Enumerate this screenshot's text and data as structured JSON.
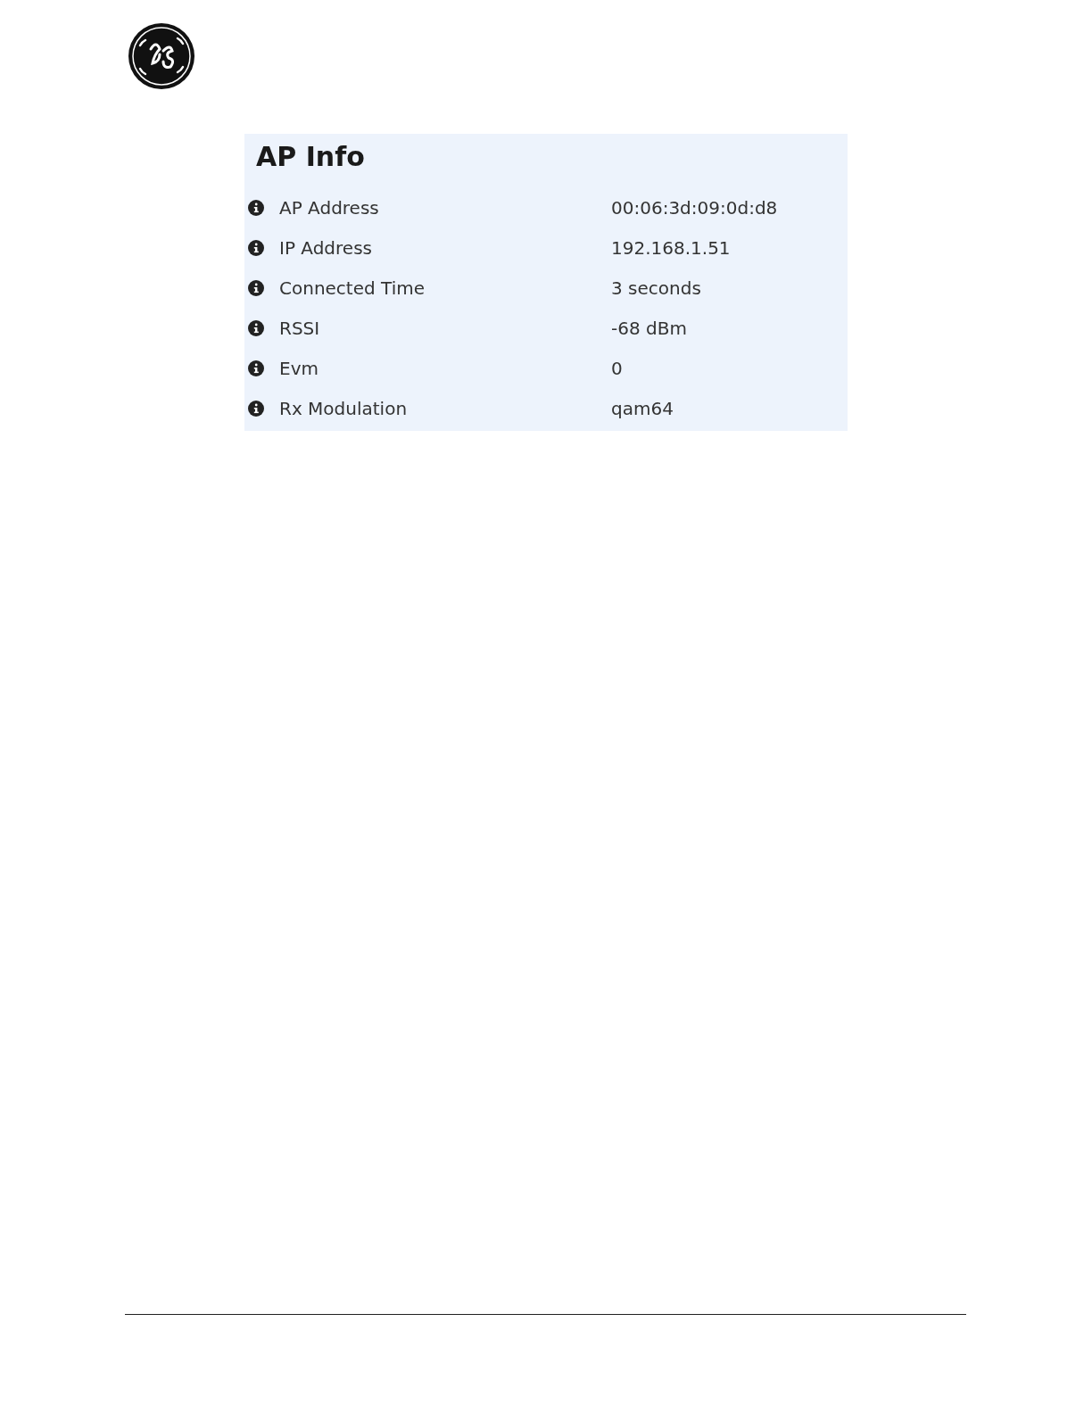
{
  "panel": {
    "title": "AP Info",
    "rows": [
      {
        "label": "AP Address",
        "value": "00:06:3d:09:0d:d8"
      },
      {
        "label": "IP Address",
        "value": "192.168.1.51"
      },
      {
        "label": "Connected Time",
        "value": "3 seconds"
      },
      {
        "label": "RSSI",
        "value": "-68 dBm"
      },
      {
        "label": "Evm",
        "value": "0"
      },
      {
        "label": "Rx Modulation",
        "value": "qam64"
      }
    ]
  }
}
